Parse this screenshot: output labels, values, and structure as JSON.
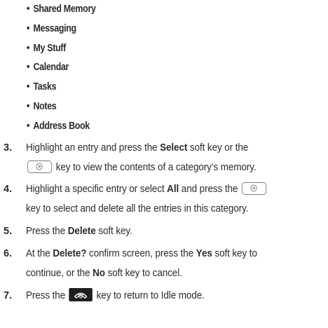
{
  "bullets": [
    "Shared Memory",
    "Messaging",
    "My Stuff",
    "Calendar",
    "Tasks",
    "Notes",
    "Address Book"
  ],
  "bullet_symbol": "•",
  "steps": [
    {
      "number": "3.",
      "line1_a": "Highlight an entry and press the ",
      "line1_b": "Select",
      "line1_c": " soft key or the",
      "line2_a": " key to view the contents of a category’s memory."
    },
    {
      "number": "4.",
      "line1_a": "Highlight a specific entry or select ",
      "line1_b": "All",
      "line1_c": " and press the",
      "line2_a": "key to select and delete all the entries in this category."
    },
    {
      "number": "5.",
      "line1_a": "Press the ",
      "line1_b": "Delete",
      "line1_c": " soft key."
    },
    {
      "number": "6.",
      "line1_a": "At the ",
      "line1_b": "Delete?",
      "line1_c": " confirm screen, press the ",
      "line1_d": "Yes",
      "line1_e": " soft key to",
      "line2_a": "continue, or the ",
      "line2_b": "No",
      "line2_c": " soft key to cancel."
    },
    {
      "number": "7.",
      "line1_a": "Press the ",
      "line1_c": " key to return to Idle mode."
    }
  ],
  "icons": {
    "ok_key": "ok-key-icon",
    "end_key": "end-key-icon"
  },
  "colors": {
    "text": "#2b2b2b",
    "key_border": "#7a7a7a",
    "end_key_bg": "#1e1e1e"
  }
}
